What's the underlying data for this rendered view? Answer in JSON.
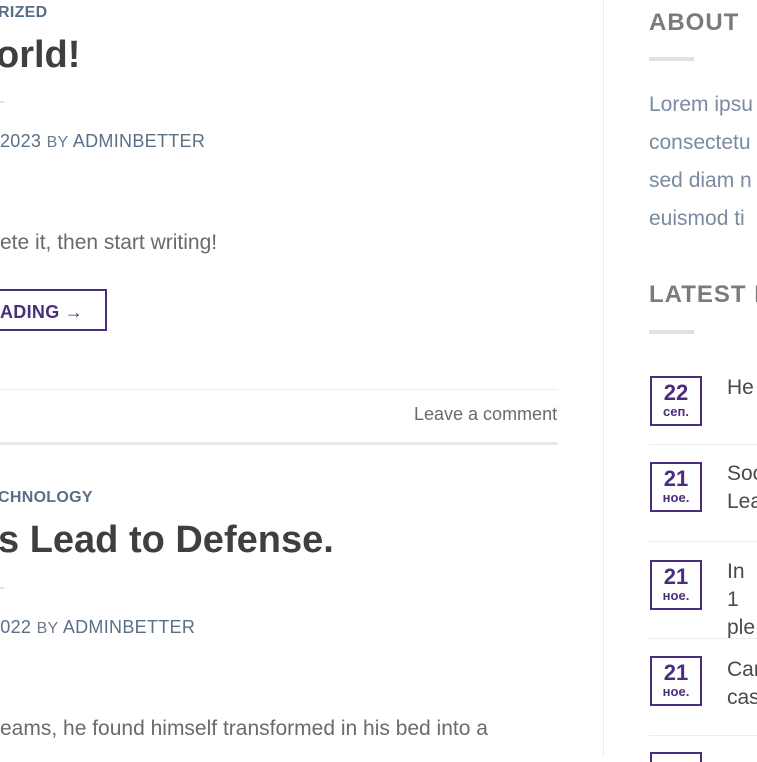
{
  "posts": [
    {
      "category": "RIZED",
      "title": "orld!",
      "date_part": "2023",
      "by_label": "BY",
      "author": "ADMINBETTER",
      "excerpt": "ete it, then start writing!",
      "read_more": "ADING →",
      "comment_link": "Leave a comment"
    },
    {
      "category": "CHNOLOGY",
      "title": "s Lead to Defense.",
      "date_part": "2022",
      "by_label": "BY",
      "author": "ADMINBETTER",
      "excerpt": "eams, he found himself transformed in his bed into a"
    }
  ],
  "sidebar": {
    "about": {
      "title": "ABOUT",
      "lines": [
        "Lorem ipsu",
        "consectetu",
        "sed diam n",
        "euismod ti"
      ]
    },
    "latest": {
      "title": "LATEST P",
      "items": [
        {
          "day": "22",
          "month": "сеп.",
          "title_lines": [
            "He"
          ]
        },
        {
          "day": "21",
          "month": "ное.",
          "title_lines": [
            "Soc",
            "Lea"
          ]
        },
        {
          "day": "21",
          "month": "ное.",
          "title_lines": [
            "In 1",
            "ple"
          ]
        },
        {
          "day": "21",
          "month": "ное.",
          "title_lines": [
            "Car",
            "cas"
          ]
        }
      ]
    }
  }
}
